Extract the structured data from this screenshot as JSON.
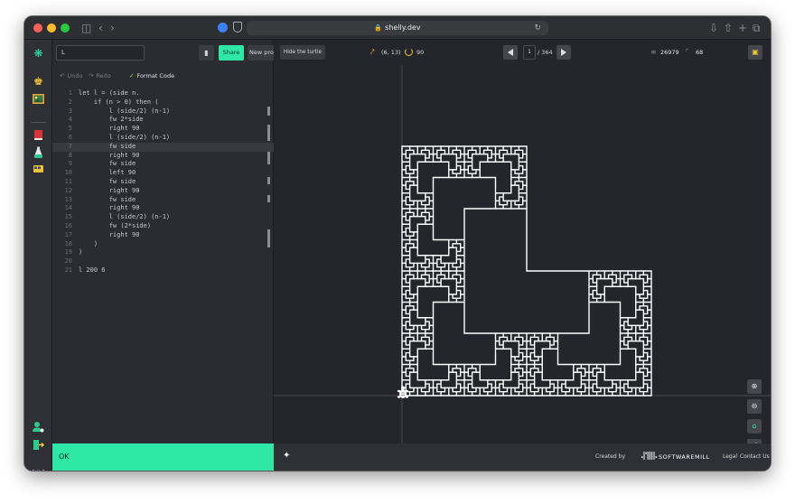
{
  "browser": {
    "url": "shelly.dev"
  },
  "sidebar": {
    "icons": [
      "turtle-logo-icon",
      "trophy-icon",
      "gallery-icon",
      "book-icon",
      "potion-icon",
      "bus-icon",
      "user-settings-icon",
      "exit-icon",
      "uk-flag-icon"
    ]
  },
  "editor": {
    "program_name": "L",
    "share_label": "Share",
    "new_program_label": "New program",
    "undo_label": "Undo",
    "redo_label": "Redo",
    "format_label": "Format Code",
    "code_lines": [
      "let l = (side n.",
      "    if (n > 0) then (",
      "        l (side/2) (n-1)",
      "        fw 2*side",
      "        right 90",
      "        l (side/2) (n-1)",
      "        fw side",
      "        right 90",
      "        fw side",
      "        left 90",
      "        fw side",
      "        right 90",
      "        fw side",
      "        right 90",
      "        l (side/2) (n-1)",
      "        fw (2*side)",
      "        right 90",
      "    )",
      ")",
      "",
      "l 200 6"
    ],
    "status": "OK"
  },
  "canvas": {
    "hide_turtle_label": "Hide the turtle",
    "position": "(6, 13)",
    "angle": "90",
    "step_current": "1",
    "step_total": "/ 364",
    "lines_count": "26979",
    "steps_count": "68"
  },
  "footer": {
    "created_by": "Created by",
    "company_logo": ".|'||||.",
    "company_name": "SOFTWAREMILL",
    "legal_label": "Legal",
    "contact_label": "Contact Us"
  },
  "colors": {
    "accent": "#2ee6a6",
    "background": "#24262b",
    "turtle_line": "#ffffff"
  }
}
